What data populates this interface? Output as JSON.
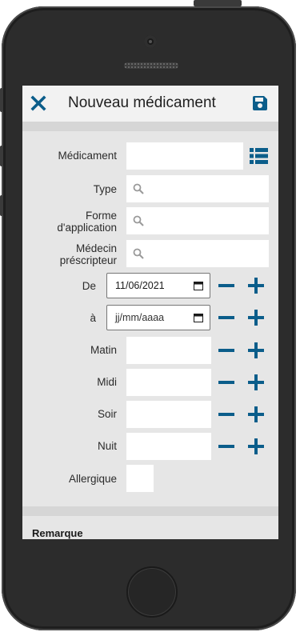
{
  "header": {
    "title": "Nouveau médicament",
    "close_icon": "close-icon",
    "save_icon": "save-icon"
  },
  "form": {
    "medicament": {
      "label": "Médicament",
      "value": ""
    },
    "type": {
      "label": "Type",
      "value": ""
    },
    "forme": {
      "label_line1": "Forme",
      "label_line2": "d'application",
      "value": ""
    },
    "medecin": {
      "label_line1": "Médecin",
      "label_line2": "préscripteur",
      "value": ""
    },
    "de": {
      "label": "De",
      "value": "11/06/2021"
    },
    "a": {
      "label": "à",
      "value": "jj/mm/aaaa"
    },
    "matin": {
      "label": "Matin",
      "value": ""
    },
    "midi": {
      "label": "Midi",
      "value": ""
    },
    "soir": {
      "label": "Soir",
      "value": ""
    },
    "nuit": {
      "label": "Nuit",
      "value": ""
    },
    "allergique": {
      "label": "Allergique",
      "checked": false
    }
  },
  "remarque": {
    "label": "Remarque"
  },
  "colors": {
    "accent": "#0b5d8a",
    "background": "#e6e6e6",
    "header": "#f2f2f2"
  }
}
